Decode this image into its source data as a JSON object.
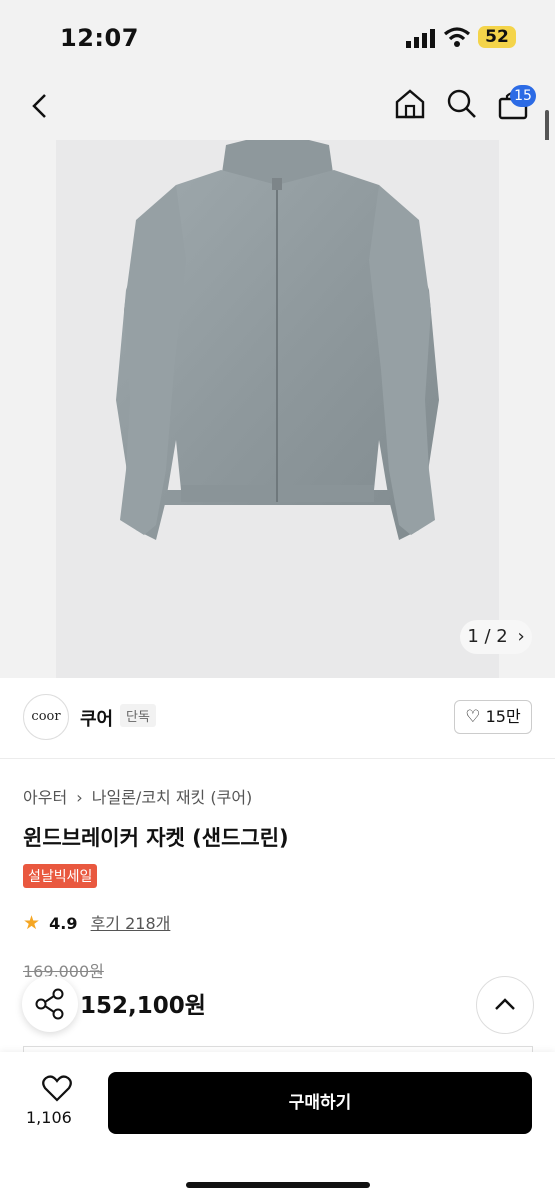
{
  "status": {
    "time": "12:07",
    "battery": "52"
  },
  "nav": {
    "cart_count": "15"
  },
  "gallery": {
    "pager": "1 / 2"
  },
  "brand": {
    "logo_text": "coor",
    "name": "쿠어",
    "tag": "단독",
    "likes": "15만"
  },
  "product": {
    "breadcrumb": [
      "아우터",
      "나일론/코치 재킷 (쿠어)"
    ],
    "title": "윈드브레이커 자켓 (샌드그린)",
    "sale_badge": "설날빅세일",
    "rating": "4.9",
    "reviews": "후기 218개",
    "original_price": "169,000원",
    "price": "152,100원"
  },
  "bottom": {
    "wish_count": "1,106",
    "buy_label": "구매하기"
  },
  "colors": {
    "accent_blue": "#2c6be5",
    "sale_red": "#e9583f",
    "star": "#f5a623"
  }
}
